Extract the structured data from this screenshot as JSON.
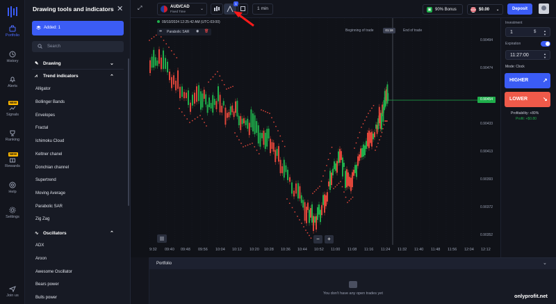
{
  "rail": {
    "items": [
      {
        "label": "Portfolio",
        "icon": "portfolio-icon",
        "active": true
      },
      {
        "label": "History",
        "icon": "history-icon"
      },
      {
        "label": "Alerts",
        "icon": "alerts-icon"
      },
      {
        "label": "Signals",
        "icon": "signals-icon",
        "badge": "NEW"
      },
      {
        "label": "Ranking",
        "icon": "ranking-icon"
      },
      {
        "label": "Rewards",
        "icon": "rewards-icon",
        "badge": "NEW"
      },
      {
        "label": "Help",
        "icon": "help-icon"
      },
      {
        "label": "Settings",
        "icon": "settings-icon"
      },
      {
        "label": "Join us",
        "icon": "join-icon"
      }
    ]
  },
  "panel": {
    "title": "Drawing tools and indicators",
    "added_label": "Added: 1",
    "search_placeholder": "Search",
    "drawing_label": "Drawing",
    "trend_label": "Trend indicators",
    "trend_items": [
      "Alligator",
      "Bollinger Bands",
      "Envelopes",
      "Fractal",
      "Ichimoku Cloud",
      "Keltner chanel",
      "Donchian channel",
      "Supertrend",
      "Moving Average",
      "Parabolic SAR",
      "Zig Zag"
    ],
    "oscillators_label": "Oscillators",
    "oscillator_items": [
      "ADX",
      "Aroon",
      "Awesome Oscillator",
      "Bears power",
      "Bulls power"
    ]
  },
  "topbar": {
    "asset_name": "AUD/CAD",
    "asset_sub": "Fixed Time",
    "indicator_count": "1",
    "timeframe": "1 min",
    "bonus": "90% Bonus",
    "balance": "$0.00",
    "deposit": "Deposit"
  },
  "chart": {
    "datetime": "09/10/2024 12:25:42 AM (UTC-03:00)",
    "indicator": "Parabolic SAR",
    "beginning_label": "Beginning of trade",
    "trade_time": "01:18",
    "end_label": "End of trade",
    "current_price": "0.90454",
    "price_levels": [
      "0.90494",
      "0.90474",
      "0.90454",
      "0.90433",
      "0.90413",
      "0.90393",
      "0.90372",
      "0.90352"
    ],
    "time_labels": [
      "9:32",
      "09:40",
      "09:48",
      "09:56",
      "10:04",
      "10:12",
      "10:20",
      "10:28",
      "10:36",
      "10:44",
      "10:52",
      "11:00",
      "11:08",
      "11:16",
      "11:24",
      "11:32",
      "11:40",
      "11:48",
      "11:56",
      "12:04",
      "12:12"
    ],
    "zoom_out": "−",
    "zoom_in": "+",
    "colors": {
      "up": "#1fae4b",
      "down": "#e0463a",
      "sar": "#e0463a"
    }
  },
  "trade": {
    "investment_label": "Investment",
    "investment_value": "1",
    "investment_currency": "$",
    "expiration_label": "Expiration",
    "expiration_value": "11:27:00",
    "mode": "Mode: Clock",
    "higher": "HIGHER",
    "lower": "LOWER",
    "profitability": "Profitability: +80%",
    "profit": "Profit: +$0.80"
  },
  "portfolio": {
    "title": "Portfolio",
    "empty": "You don't have any open trades yet"
  },
  "watermark": "onlyprofit.net"
}
